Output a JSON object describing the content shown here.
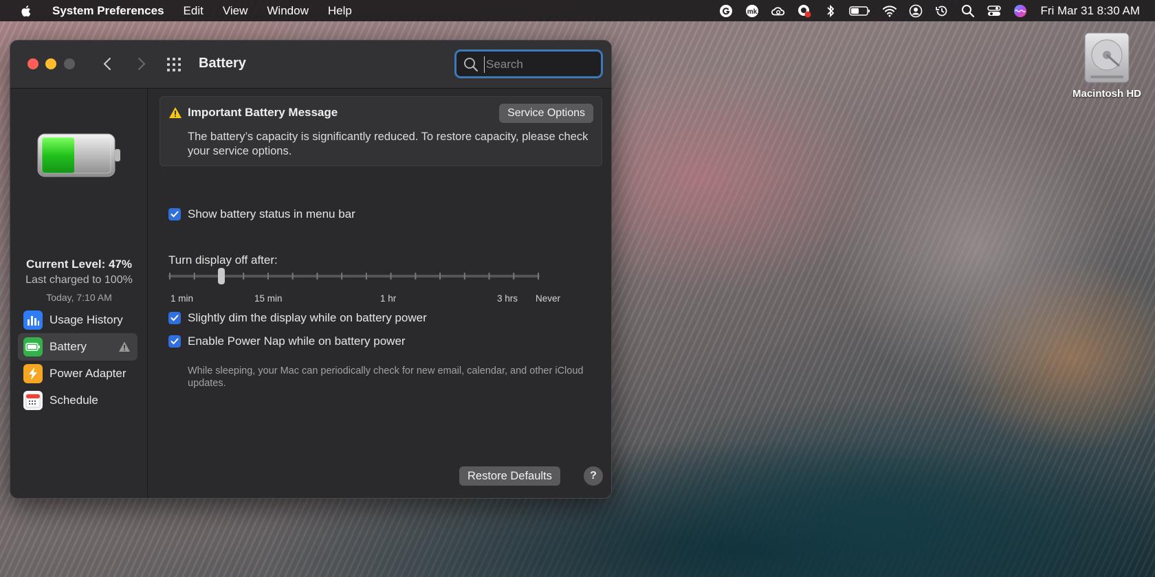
{
  "menubar": {
    "app_name": "System Preferences",
    "menus": [
      "Edit",
      "View",
      "Window",
      "Help"
    ],
    "status_icons": [
      "grammarly-icon",
      "mk-icon",
      "creative-cloud-icon",
      "screen-recorder-icon",
      "bluetooth-icon",
      "battery-icon",
      "wifi-icon",
      "user-icon",
      "time-machine-icon",
      "spotlight-icon",
      "control-center-icon",
      "siri-icon"
    ],
    "clock": "Fri Mar 31  8:30 AM"
  },
  "desktop": {
    "hd_label": "Macintosh HD"
  },
  "window": {
    "title": "Battery",
    "search_placeholder": "Search"
  },
  "sidebar": {
    "battery_level_fraction": 0.47,
    "current_level": "Current Level: 47%",
    "last_charged": "Last charged to 100%",
    "charged_time": "Today, 7:10 AM",
    "items": [
      {
        "label": "Usage History",
        "icon": "usage-history-icon"
      },
      {
        "label": "Battery",
        "icon": "battery-icon",
        "selected": true,
        "warning": true
      },
      {
        "label": "Power Adapter",
        "icon": "power-adapter-icon"
      },
      {
        "label": "Schedule",
        "icon": "calendar-icon"
      }
    ]
  },
  "main": {
    "message": {
      "title": "Important Battery Message",
      "button": "Service Options",
      "body": "The battery’s capacity is significantly reduced. To restore capacity, please check your service options."
    },
    "show_status": {
      "label": "Show battery status in menu bar",
      "checked": true
    },
    "display_off": {
      "label": "Turn display off after:",
      "tick_labels": [
        "1 min",
        "15 min",
        "1 hr",
        "3 hrs",
        "Never"
      ],
      "value": "3 min"
    },
    "dim_display": {
      "label": "Slightly dim the display while on battery power",
      "checked": true
    },
    "power_nap": {
      "label": "Enable Power Nap while on battery power",
      "checked": true,
      "description": "While sleeping, your Mac can periodically check for new email, calendar, and other iCloud updates."
    },
    "restore_button": "Restore Defaults",
    "help_button": "?"
  },
  "colors": {
    "accent": "#2f6fde",
    "search_focus": "#3d79b8",
    "warning": "#f5c518",
    "battery_green": "#22c21c"
  }
}
